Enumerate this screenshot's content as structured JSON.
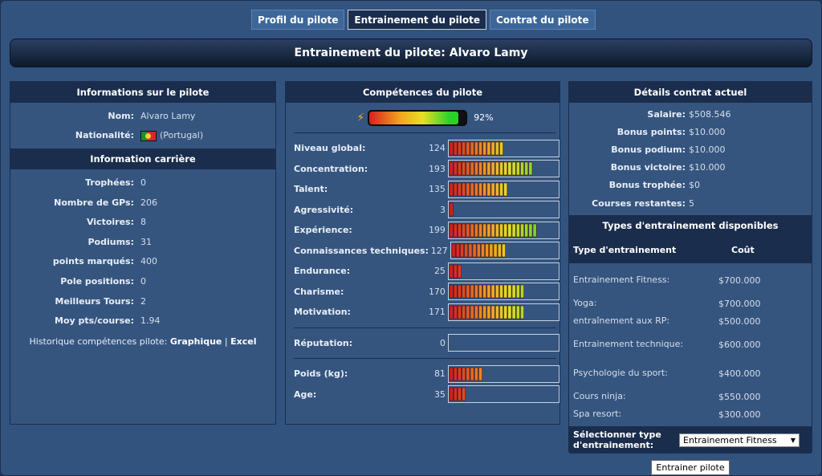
{
  "tabs": [
    {
      "label": "Profil du pilote",
      "active": false
    },
    {
      "label": "Entrainement du pilote",
      "active": true
    },
    {
      "label": "Contrat du pilote",
      "active": false
    }
  ],
  "page_title": "Entrainement du pilote: Alvaro Lamy",
  "driver_info": {
    "title": "Informations sur le pilote",
    "name_label": "Nom:",
    "name_value": "Alvaro Lamy",
    "nationality_label": "Nationalité:",
    "nationality_value": "(Portugal)",
    "flag_icon": "portugal-flag-icon"
  },
  "career": {
    "title": "Information carrière",
    "rows": [
      {
        "label": "Trophées:",
        "value": "0"
      },
      {
        "label": "Nombre de GPs:",
        "value": "206"
      },
      {
        "label": "Victoires:",
        "value": "8"
      },
      {
        "label": "Podiums:",
        "value": "31"
      },
      {
        "label": "points marqués:",
        "value": "400"
      },
      {
        "label": "Pole positions:",
        "value": "0"
      },
      {
        "label": "Meilleurs Tours:",
        "value": "2"
      },
      {
        "label": "Moy pts/course:",
        "value": "1.94"
      }
    ],
    "history_label": "Historique compétences pilote:",
    "history_graph": "Graphique",
    "history_sep": "|",
    "history_excel": "Excel"
  },
  "skills": {
    "title": "Compétences du pilote",
    "overall_percent": 92,
    "overall_label": "92%",
    "bolt_icon": "lightning-bolt-icon",
    "max_value": 250,
    "groups": [
      [
        {
          "label": "Niveau global:",
          "value": "124",
          "level": 124
        },
        {
          "label": "Concentration:",
          "value": "193",
          "level": 193
        },
        {
          "label": "Talent:",
          "value": "135",
          "level": 135
        },
        {
          "label": "Agressivité:",
          "value": "3",
          "level": 3
        },
        {
          "label": "Expérience:",
          "value": "199",
          "level": 199
        },
        {
          "label": "Connaissances techniques:",
          "value": "127",
          "level": 127
        },
        {
          "label": "Endurance:",
          "value": "25",
          "level": 25
        },
        {
          "label": "Charisme:",
          "value": "170",
          "level": 170
        },
        {
          "label": "Motivation:",
          "value": "171",
          "level": 171
        }
      ],
      [
        {
          "label": "Réputation:",
          "value": "0",
          "level": 0
        }
      ],
      [
        {
          "label": "Poids (kg):",
          "value": "81",
          "level": 81
        },
        {
          "label": "Age:",
          "value": "35",
          "level": 35
        }
      ]
    ]
  },
  "contract": {
    "title": "Détails contrat actuel",
    "rows": [
      {
        "label": "Salaire:",
        "value": "$508.546"
      },
      {
        "label": "Bonus points:",
        "value": "$10.000"
      },
      {
        "label": "Bonus podium:",
        "value": "$10.000"
      },
      {
        "label": "Bonus victoire:",
        "value": "$10.000"
      },
      {
        "label": "Bonus trophée:",
        "value": "$0"
      },
      {
        "label": "Courses restantes:",
        "value": "5"
      }
    ]
  },
  "training": {
    "title": "Types d'entrainement disponibles",
    "col_type": "Type d'entrainement",
    "col_cost": "Coût",
    "rows": [
      {
        "type": "Entrainement Fitness:",
        "cost": "$700.000"
      },
      {
        "type": "Yoga:",
        "cost": "$700.000"
      },
      {
        "type": "entraînement aux RP:",
        "cost": "$500.000"
      },
      {
        "type": "Entrainement technique:",
        "cost": "$600.000"
      },
      {
        "type": "Psychologie du sport:",
        "cost": "$400.000"
      },
      {
        "type": "Cours ninja:",
        "cost": "$550.000"
      },
      {
        "type": "Spa resort:",
        "cost": "$300.000"
      }
    ],
    "select_label": "Sélectionner type d'entrainement:",
    "select_value": "Entrainement Fitness",
    "submit_label": "Entrainer pilote"
  }
}
